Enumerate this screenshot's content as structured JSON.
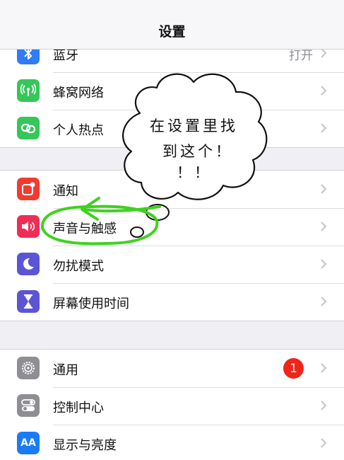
{
  "navbar": {
    "title": "设置"
  },
  "groups": [
    {
      "rows": [
        {
          "label": "蓝牙",
          "value": "打开",
          "icon": "bluetooth-icon",
          "color": "#2f7cf6"
        },
        {
          "label": "蜂窝网络",
          "icon": "cellular-antenna-icon",
          "color": "#34c759"
        },
        {
          "label": "个人热点",
          "icon": "hotspot-link-icon",
          "color": "#34c759"
        }
      ]
    },
    {
      "rows": [
        {
          "label": "通知",
          "icon": "notifications-icon",
          "color": "#f23b30"
        },
        {
          "label": "声音与触感",
          "icon": "speaker-icon",
          "color": "#f02d55"
        },
        {
          "label": "勿扰模式",
          "icon": "moon-icon",
          "color": "#5b55d6"
        },
        {
          "label": "屏幕使用时间",
          "icon": "hourglass-icon",
          "color": "#5b55d6"
        }
      ]
    },
    {
      "rows": [
        {
          "label": "通用",
          "badge": "1",
          "icon": "gear-icon",
          "color": "#8e8e93"
        },
        {
          "label": "控制中心",
          "icon": "toggles-icon",
          "color": "#8e8e93"
        },
        {
          "label": "显示与亮度",
          "icon": "text-size-icon",
          "icon_text": "AA",
          "color": "#1a7cf5"
        }
      ]
    }
  ],
  "annotation": {
    "line1": "在设置里找",
    "line2": "到这个！",
    "line3": "！！",
    "stroke_color": "#3fd11f"
  }
}
